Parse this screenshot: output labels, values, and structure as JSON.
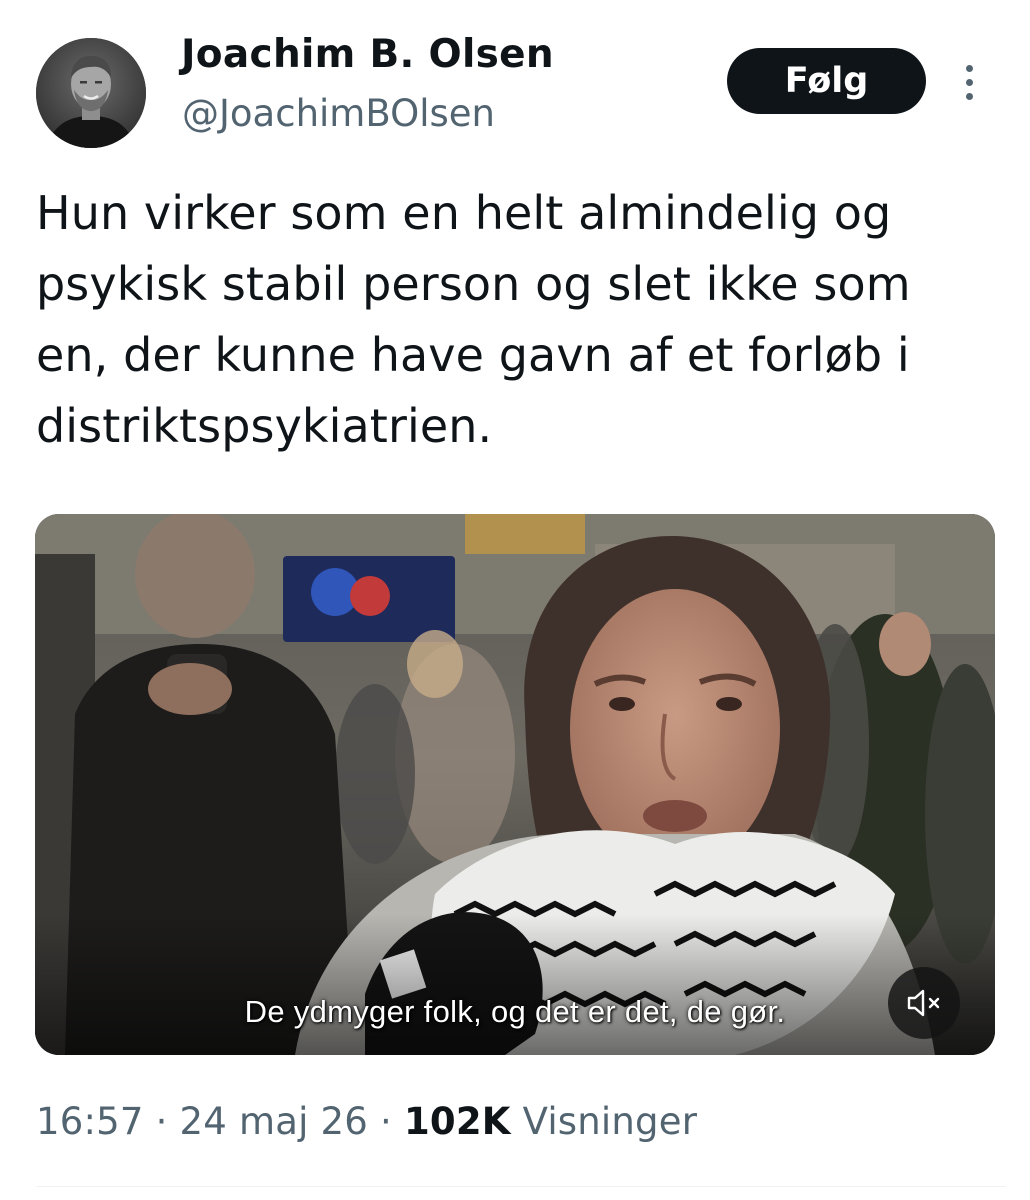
{
  "author": {
    "name": "Joachim B. Olsen",
    "handle": "@JoachimBOlsen"
  },
  "follow_label": "Følg",
  "more_icon": "more-vertical-icon",
  "tweet": {
    "lines": [
      "Hun virker som en helt almindelig og",
      "psykisk stabil person og slet ikke som",
      "en, der kunne have gavn af et forløb i",
      "distriktspsykiatrien."
    ]
  },
  "media": {
    "subtitle": "De ydmyger folk, og det er det, de gør.",
    "mute_icon": "speaker-muted-icon"
  },
  "meta": {
    "time": "16:57",
    "date": "24 maj 26",
    "views_count": "102K",
    "views_label": "Visninger",
    "separator": "·"
  },
  "colors": {
    "text": "#0f1419",
    "secondary": "#536471",
    "button_bg": "#0f1419",
    "button_text": "#ffffff"
  }
}
